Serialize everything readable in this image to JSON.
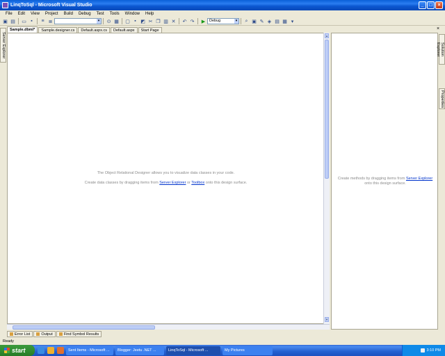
{
  "window": {
    "title": "LinqToSql - Microsoft Visual Studio",
    "min": "_",
    "max": "□",
    "close": "×"
  },
  "menu": [
    "File",
    "Edit",
    "View",
    "Project",
    "Build",
    "Debug",
    "Test",
    "Tools",
    "Window",
    "Help"
  ],
  "toolbar": {
    "config_value": "Debug",
    "combo_arrow": "▾"
  },
  "tabs": [
    "Sample.dbml*",
    "Sample.designer.cs",
    "Default.aspx.cs",
    "Default.aspx",
    "Start Page"
  ],
  "doc_close": "×",
  "left_side_tabs": [
    "Server Explorer"
  ],
  "right_side_tabs": [
    "Solution Explorer",
    "Properties"
  ],
  "designer": {
    "line1": "The Object Relational Designer allows you to visualize data classes in your code.",
    "line2_prefix": "Create data classes by dragging items from ",
    "line2_link1": "Server Explorer",
    "line2_mid": " or ",
    "line2_link2": "Toolbox",
    "line2_suffix": " onto this design surface."
  },
  "methods_pane": {
    "prefix": "Create methods by dragging items from ",
    "link": "Server Explorer",
    "suffix": "onto this design surface."
  },
  "bottom_tabs": [
    "Error List",
    "Output",
    "Find Symbol Results"
  ],
  "status": "Ready",
  "taskbar": {
    "start": "start",
    "tasks": [
      "Sent Items - Microsoft ...",
      "Blogger: Jeetu .NET ...",
      "LinqToSql - Microsoft ...",
      "My Pictures"
    ],
    "time": "3:10 PM"
  }
}
